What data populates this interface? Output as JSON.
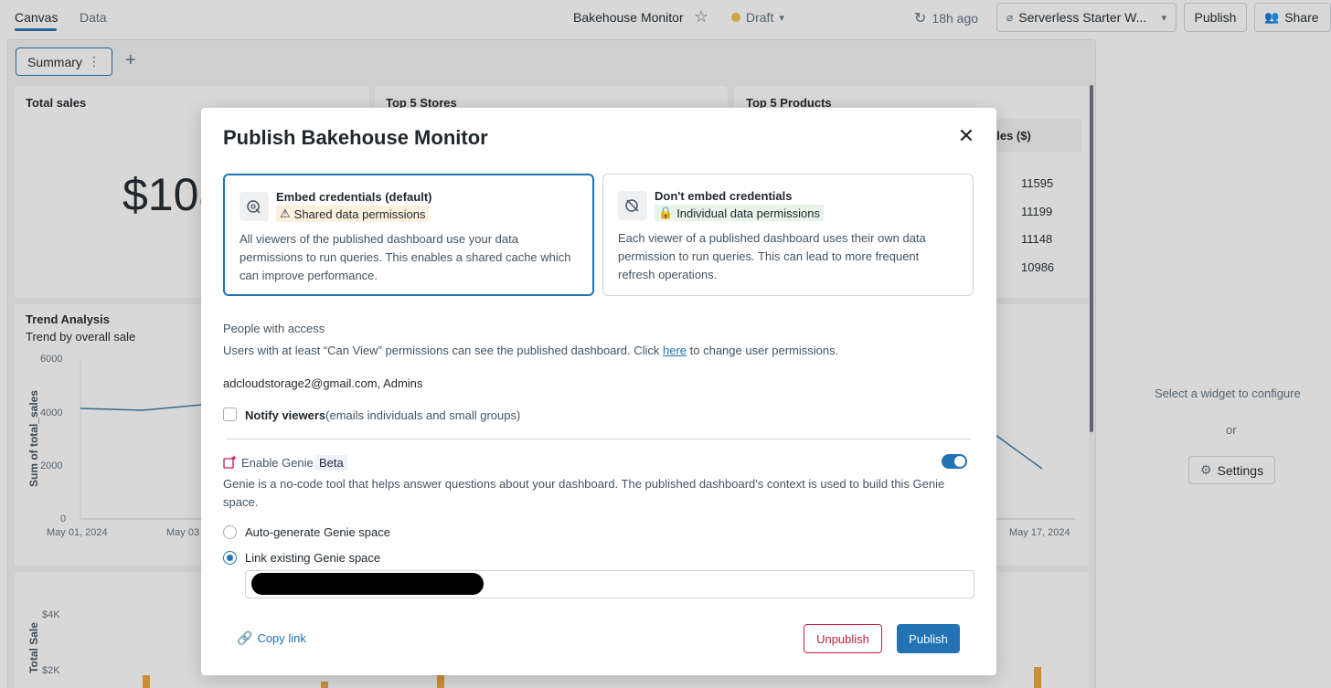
{
  "topbar": {
    "tab_canvas": "Canvas",
    "tab_data": "Data",
    "title": "Bakehouse Monitor",
    "status": "Draft",
    "refresh": "18h ago",
    "warehouse": "Serverless Starter W...",
    "publish": "Publish",
    "share": "Share"
  },
  "canvas": {
    "page_tab": "Summary",
    "widgets": {
      "total_sales": {
        "title": "Total sales",
        "value": "$108"
      },
      "top_stores": {
        "title": "Top 5 Stores"
      },
      "top_products": {
        "title": "Top 5 Products",
        "column": "ales ($)",
        "values": [
          "11595",
          "11199",
          "11148",
          "10986"
        ]
      },
      "trend": {
        "title": "Trend Analysis",
        "subtitle": "Trend by overall sale",
        "ylabel": "Sum of total_sales",
        "yticks": [
          "6000",
          "4000",
          "2000",
          "0"
        ],
        "xticks": [
          "May 01, 2024",
          "May 03",
          "May 17, 2024"
        ]
      },
      "bottom": {
        "ylabel": "Total Sale",
        "yticks": [
          "$4K",
          "$2K"
        ]
      }
    }
  },
  "right_panel": {
    "hint": "Select a widget to configure",
    "or": "or",
    "settings": "Settings"
  },
  "modal": {
    "title": "Publish Bakehouse Monitor",
    "embed": {
      "title": "Embed credentials (default)",
      "badge": "Shared data permissions",
      "body": "All viewers of the published dashboard use your data permissions to run queries. This enables a shared cache which can improve performance."
    },
    "no_embed": {
      "title": "Don't embed credentials",
      "badge": "Individual data permissions",
      "body": "Each viewer of a published dashboard uses their own data permission to run queries. This can lead to more frequent refresh operations."
    },
    "access_label": "People with access",
    "access_text_1": "Users with at least “Can View” permissions can see the published dashboard. Click ",
    "access_link": "here",
    "access_text_2": " to change user permissions.",
    "users": "adcloudstorage2@gmail.com, Admins",
    "notify_label": "Notify viewers",
    "notify_hint": "(emails individuals and small groups)",
    "genie_label": "Enable Genie",
    "genie_beta": "Beta",
    "genie_desc": "Genie is a no-code tool that helps answer questions about your dashboard. The published dashboard's context is used to build this Genie space.",
    "radio_auto": "Auto-generate Genie space",
    "radio_link": "Link existing Genie space",
    "copy_link": "Copy link",
    "unpublish": "Unpublish",
    "publish": "Publish"
  },
  "colors": {
    "accent": "#2272b4",
    "danger": "#c3233d",
    "warn_bg": "#fdf1dd",
    "ok_bg": "#e6f4ea"
  }
}
